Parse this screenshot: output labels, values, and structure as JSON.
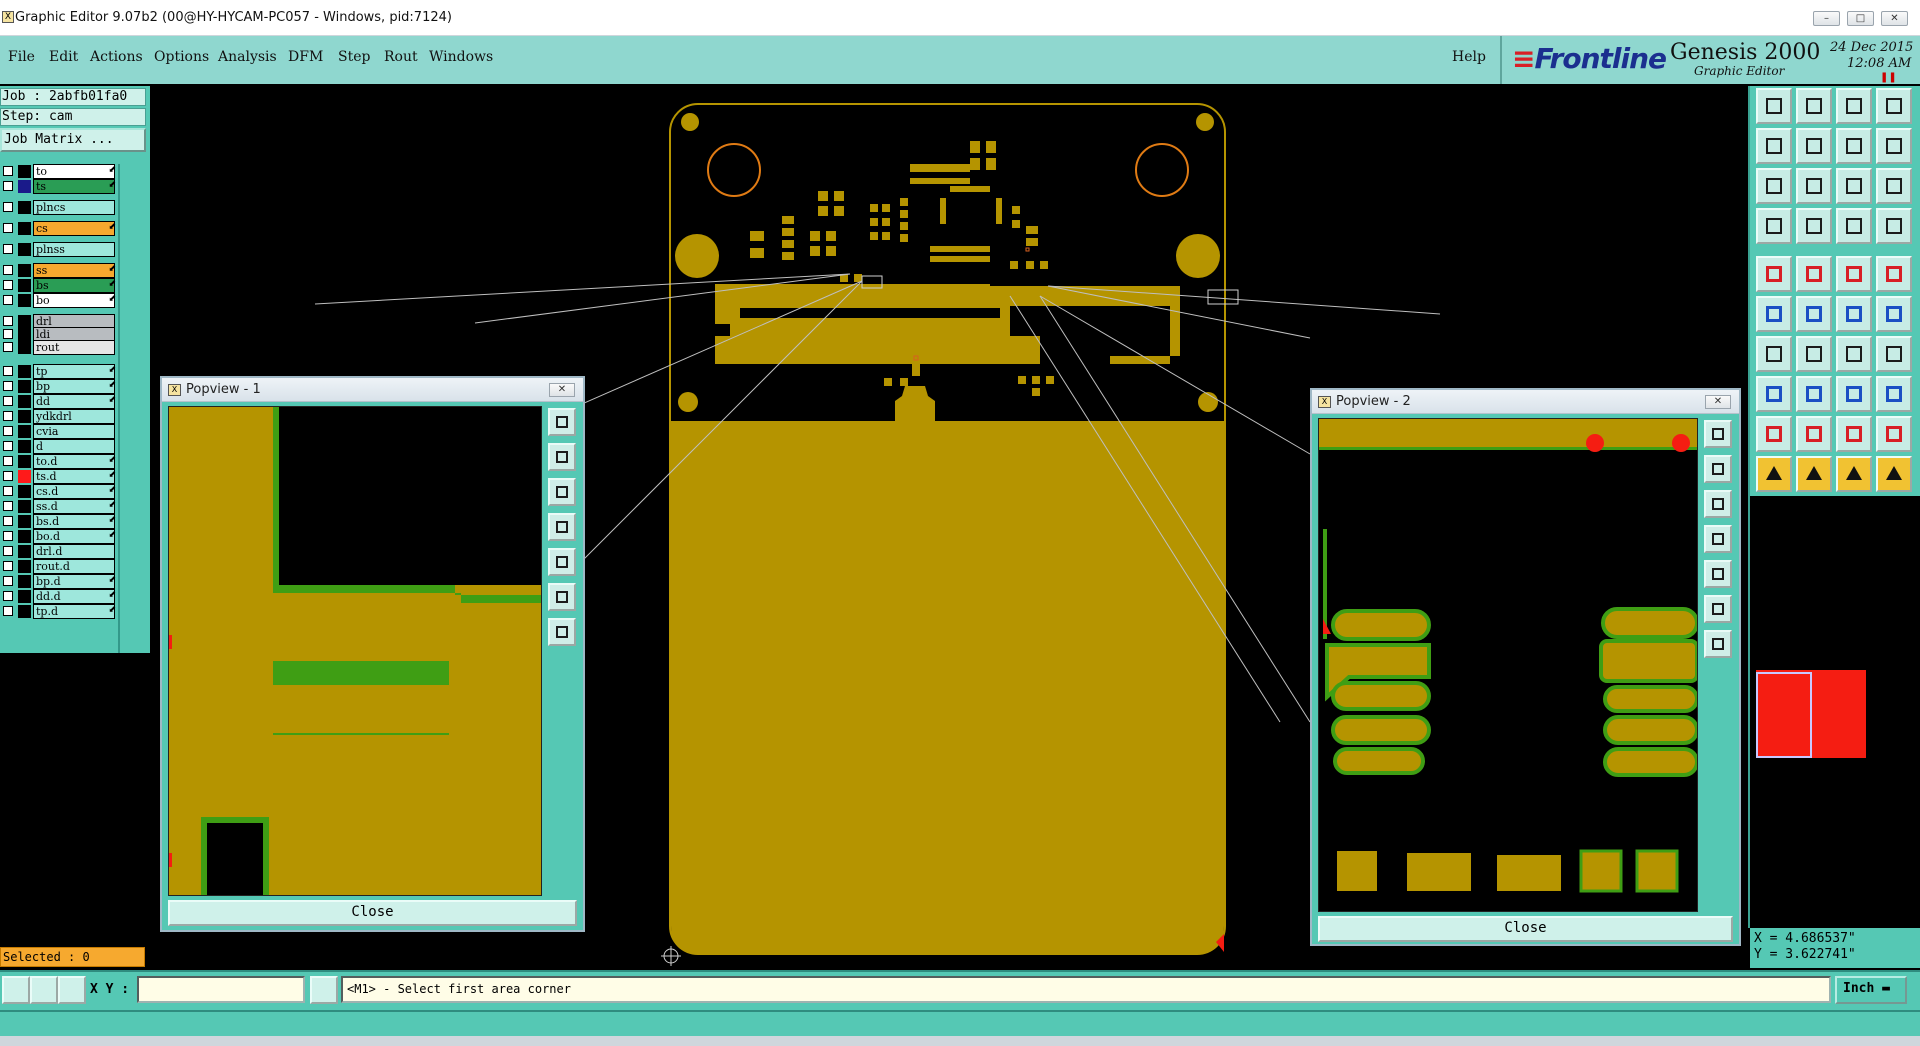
{
  "window": {
    "title": "Graphic Editor 9.07b2 (00@HY-HYCAM-PC057 - Windows, pid:7124)",
    "app_icon": "X",
    "controls": [
      "minimize-icon",
      "maximize-icon",
      "close-icon"
    ]
  },
  "menu": {
    "items": [
      "File",
      "Edit",
      "Actions",
      "Options",
      "Analysis",
      "DFM",
      "Step",
      "Rout",
      "Windows"
    ],
    "help": "Help"
  },
  "brand": {
    "logo": "Frontline",
    "product": "Genesis 2000",
    "subtitle": "Graphic Editor",
    "date": "24 Dec 2015",
    "time": "12:08 AM"
  },
  "job": {
    "job_line": "Job : 2abfb01fa0",
    "step_line": "Step: cam",
    "matrix_button": "Job Matrix ..."
  },
  "layers": [
    {
      "name": "to",
      "color": "#ffffff",
      "checked": false,
      "arrow": true,
      "square": "#000000"
    },
    {
      "name": "ts",
      "color": "#2a9d55",
      "checked": true,
      "arrow": true,
      "square": "#1a1a8a"
    },
    {
      "name": "plncs",
      "color": "#9ee7dc",
      "checked": false,
      "arrow": false,
      "square": "#000000"
    },
    {
      "name": "cs",
      "color": "#f6a92f",
      "checked": false,
      "arrow": true,
      "square": "#000000"
    },
    {
      "name": "plnss",
      "color": "#9ee7dc",
      "checked": false,
      "arrow": false,
      "square": "#000000"
    },
    {
      "name": "ss",
      "color": "#f6a92f",
      "checked": false,
      "arrow": true,
      "square": "#000000"
    },
    {
      "name": "bs",
      "color": "#2a9d55",
      "checked": false,
      "arrow": true,
      "square": "#000000"
    },
    {
      "name": "bo",
      "color": "#ffffff",
      "checked": false,
      "arrow": true,
      "square": "#000000"
    },
    {
      "name": "drl",
      "color": "#b8bcc0",
      "checked": false,
      "arrow": false,
      "square": "#000000"
    },
    {
      "name": "ldi",
      "color": "#b8bcc0",
      "checked": false,
      "arrow": false,
      "square": "#000000"
    },
    {
      "name": "rout",
      "color": "#e6e6e6",
      "checked": false,
      "arrow": false,
      "square": "#000000"
    },
    {
      "name": "tp",
      "color": "#9ee7dc",
      "checked": false,
      "arrow": true,
      "square": "#000000"
    },
    {
      "name": "bp",
      "color": "#9ee7dc",
      "checked": false,
      "arrow": true,
      "square": "#000000"
    },
    {
      "name": "dd",
      "color": "#9ee7dc",
      "checked": false,
      "arrow": true,
      "square": "#000000"
    },
    {
      "name": "ydkdrl",
      "color": "#9ee7dc",
      "checked": false,
      "arrow": false,
      "square": "#000000"
    },
    {
      "name": "cvia",
      "color": "#9ee7dc",
      "checked": false,
      "arrow": false,
      "square": "#000000"
    },
    {
      "name": "d",
      "color": "#9ee7dc",
      "checked": false,
      "arrow": false,
      "square": "#000000"
    },
    {
      "name": "to.d",
      "color": "#9ee7dc",
      "checked": false,
      "arrow": true,
      "square": "#000000"
    },
    {
      "name": "ts.d",
      "color": "#9ee7dc",
      "checked": false,
      "arrow": true,
      "square": "#ff1a1a"
    },
    {
      "name": "cs.d",
      "color": "#9ee7dc",
      "checked": false,
      "arrow": true,
      "square": "#000000"
    },
    {
      "name": "ss.d",
      "color": "#9ee7dc",
      "checked": false,
      "arrow": true,
      "square": "#000000"
    },
    {
      "name": "bs.d",
      "color": "#9ee7dc",
      "checked": false,
      "arrow": true,
      "square": "#000000"
    },
    {
      "name": "bo.d",
      "color": "#9ee7dc",
      "checked": false,
      "arrow": true,
      "square": "#000000"
    },
    {
      "name": "drl.d",
      "color": "#9ee7dc",
      "checked": false,
      "arrow": false,
      "square": "#000000"
    },
    {
      "name": "rout.d",
      "color": "#9ee7dc",
      "checked": false,
      "arrow": false,
      "square": "#000000"
    },
    {
      "name": "bp.d",
      "color": "#9ee7dc",
      "checked": false,
      "arrow": true,
      "square": "#000000"
    },
    {
      "name": "dd.d",
      "color": "#9ee7dc",
      "checked": false,
      "arrow": true,
      "square": "#000000"
    },
    {
      "name": "tp.d",
      "color": "#9ee7dc",
      "checked": false,
      "arrow": true,
      "square": "#000000"
    }
  ],
  "selected": "Selected : 0",
  "popview1": {
    "title": "Popview - 1",
    "close": "Close"
  },
  "popview2": {
    "title": "Popview - 2",
    "close": "Close"
  },
  "coords": {
    "x": "X = 4.686537\"",
    "y": "Y = 3.622741\""
  },
  "status": {
    "xy_label": "X Y :",
    "xy_value": "",
    "prompt": "<M1> - Select first area corner",
    "units": "Inch"
  },
  "colors": {
    "copper": "#b59400",
    "mask": "#3f9e14",
    "pad": "#c29f00",
    "accent": "#55c8b4",
    "highlight": "#f51d12"
  }
}
